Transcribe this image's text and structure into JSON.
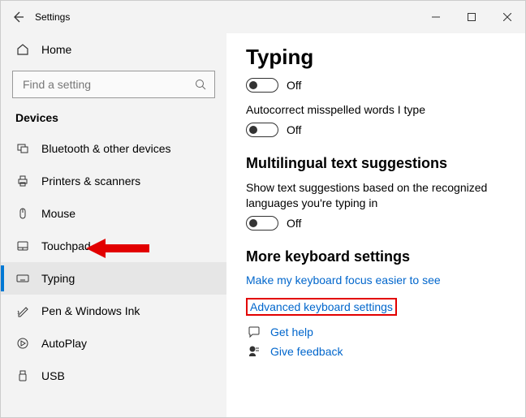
{
  "window": {
    "title": "Settings"
  },
  "sidebar": {
    "home": "Home",
    "search_placeholder": "Find a setting",
    "section": "Devices",
    "items": [
      {
        "label": "Bluetooth & other devices"
      },
      {
        "label": "Printers & scanners"
      },
      {
        "label": "Mouse"
      },
      {
        "label": "Touchpad"
      },
      {
        "label": "Typing"
      },
      {
        "label": "Pen & Windows Ink"
      },
      {
        "label": "AutoPlay"
      },
      {
        "label": "USB"
      }
    ]
  },
  "content": {
    "heading": "Typing",
    "toggle1_state": "Off",
    "autocorrect_label": "Autocorrect misspelled words I type",
    "toggle2_state": "Off",
    "multilingual_heading": "Multilingual text suggestions",
    "multilingual_desc": "Show text suggestions based on the recognized languages you're typing in",
    "toggle3_state": "Off",
    "more_heading": "More keyboard settings",
    "link_focus": "Make my keyboard focus easier to see",
    "link_advanced": "Advanced keyboard settings",
    "link_help": "Get help",
    "link_feedback": "Give feedback"
  }
}
